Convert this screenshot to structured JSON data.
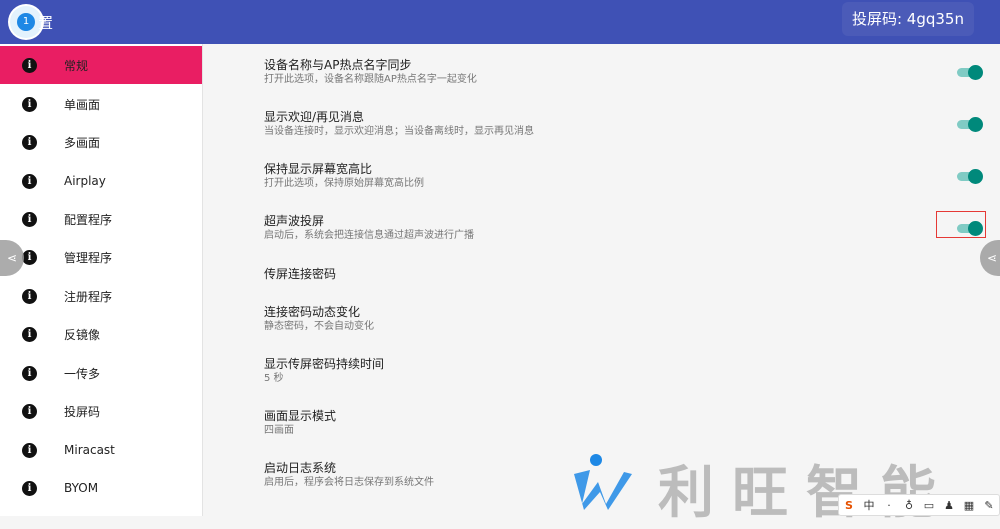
{
  "header": {
    "app_title": "置",
    "app_logo_number": "1",
    "cast_code": "投屏码: 4gq35n"
  },
  "sidebar": {
    "items": [
      {
        "label": "常规",
        "active": true
      },
      {
        "label": "单画面"
      },
      {
        "label": "多画面"
      },
      {
        "label": "Airplay"
      },
      {
        "label": "配置程序"
      },
      {
        "label": "管理程序"
      },
      {
        "label": "注册程序"
      },
      {
        "label": "反镜像"
      },
      {
        "label": "一传多"
      },
      {
        "label": "投屏码"
      },
      {
        "label": "Miracast"
      },
      {
        "label": "BYOM"
      }
    ],
    "active_color": "#e91e63"
  },
  "settings": [
    {
      "title": "设备名称与AP热点名字同步",
      "subtitle": "打开此选项，设备名称跟随AP热点名字一起变化",
      "toggle": true
    },
    {
      "title": "显示欢迎/再见消息",
      "subtitle": "当设备连接时，显示欢迎消息；当设备离线时，显示再见消息",
      "toggle": true
    },
    {
      "title": "保持显示屏幕宽高比",
      "subtitle": "打开此选项，保持原始屏幕宽高比例",
      "toggle": true
    },
    {
      "title": "超声波投屏",
      "subtitle": "启动后，系统会把连接信息通过超声波进行广播",
      "toggle": true
    },
    {
      "title": "传屏连接密码",
      "subtitle": ""
    },
    {
      "title": "连接密码动态变化",
      "subtitle": "静态密码，不会自动变化"
    },
    {
      "title": "显示传屏密码持续时间",
      "subtitle": "5 秒"
    },
    {
      "title": "画面显示模式",
      "subtitle": "四画面"
    },
    {
      "title": "启动日志系统",
      "subtitle": "启用后，程序会将日志保存到系统文件"
    }
  ],
  "watermark": {
    "text": "利旺智能"
  },
  "ime": {
    "mode": "中"
  },
  "colors": {
    "appbar": "#3f51b5",
    "toggle_on": "#00897b",
    "highlight_border": "#e53935"
  }
}
